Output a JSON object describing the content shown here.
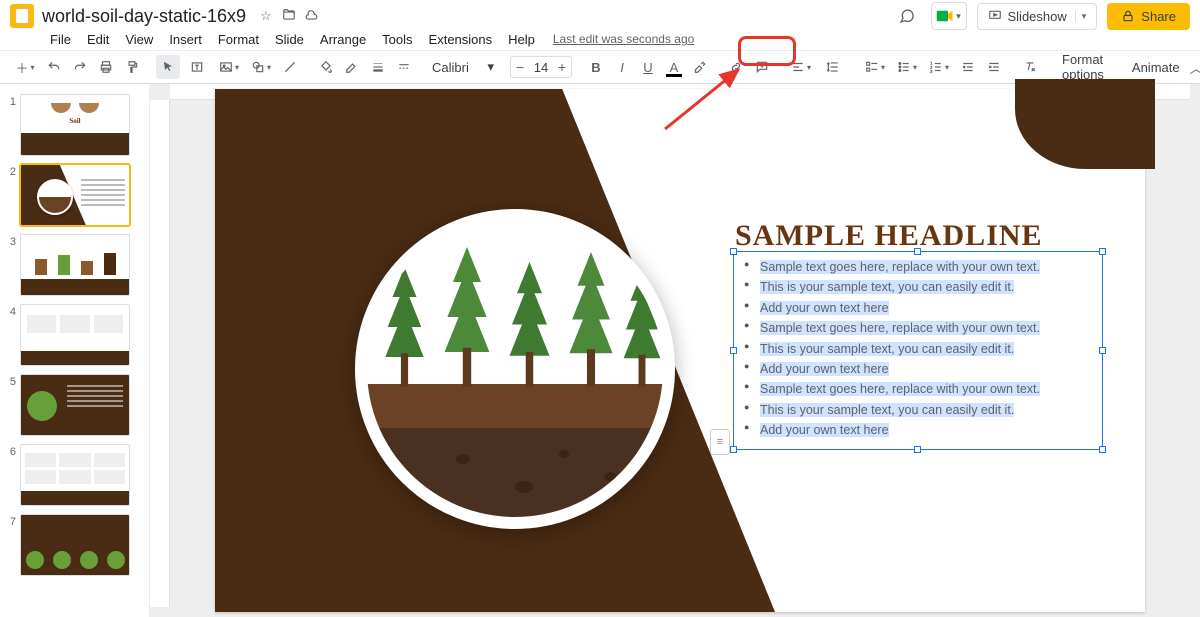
{
  "doc": {
    "title": "world-soil-day-static-16x9",
    "last_edit": "Last edit was seconds ago"
  },
  "menus": [
    "File",
    "Edit",
    "View",
    "Insert",
    "Format",
    "Slide",
    "Arrange",
    "Tools",
    "Extensions",
    "Help"
  ],
  "toolbar": {
    "font_family": "Calibri",
    "font_size": "14",
    "format_options": "Format options",
    "animate": "Animate"
  },
  "header_buttons": {
    "slideshow": "Slideshow",
    "share": "Share"
  },
  "slide": {
    "headline": "SAMPLE HEADLINE",
    "bullets": [
      "Sample text goes here, replace with your own text.",
      "This is your sample text, you can easily edit it.",
      "Add your own text here",
      "Sample text goes here, replace with your own text.",
      "This is your sample text, you can easily edit it.",
      "Add your own text here",
      "Sample text goes here, replace with your own text.",
      "This is your sample text, you can easily edit it.",
      "Add your own text here"
    ]
  },
  "thumbs": [
    "1",
    "2",
    "3",
    "4",
    "5",
    "6",
    "7"
  ],
  "colors": {
    "accent": "#f5ba14",
    "brown": "#4a2b13",
    "selection": "#cfe2ff",
    "headline": "#6b3410"
  }
}
